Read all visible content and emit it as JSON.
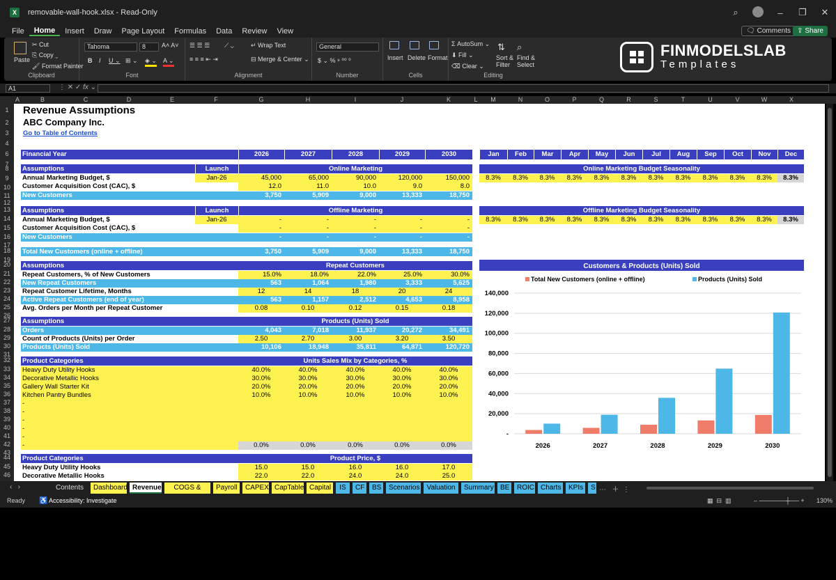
{
  "window": {
    "title": "removable-wall-hook.xlsx  -  Read-Only"
  },
  "menu": [
    "File",
    "Home",
    "Insert",
    "Draw",
    "Page Layout",
    "Formulas",
    "Data",
    "Review",
    "View"
  ],
  "menu_active": "Home",
  "buttons": {
    "comments": "Comments",
    "share": "Share"
  },
  "ribbon": {
    "clipboard": {
      "paste": "Paste",
      "cut": "Cut",
      "copy": "Copy",
      "format_painter": "Format Painter",
      "label": "Clipboard"
    },
    "font": {
      "name": "Tahoma",
      "size": "8",
      "label": "Font"
    },
    "alignment": {
      "wrap": "Wrap Text",
      "merge": "Merge & Center",
      "label": "Alignment"
    },
    "number": {
      "format": "General",
      "label": "Number"
    },
    "cells": {
      "insert": "Insert",
      "delete": "Delete",
      "format": "Format",
      "label": "Cells"
    },
    "editing": {
      "autosum": "AutoSum",
      "fill": "Fill",
      "clear": "Clear",
      "sort": "Sort & Filter",
      "find": "Find & Select",
      "label": "Editing"
    }
  },
  "logo": {
    "line1": "FINMODELSLAB",
    "line2": "Templates"
  },
  "formula": {
    "namebox": "A1",
    "fx": "fx"
  },
  "columns": [
    "A",
    "B",
    "C",
    "D",
    "E",
    "F",
    "G",
    "H",
    "I",
    "J",
    "K",
    "L",
    "M",
    "N",
    "O",
    "P",
    "Q",
    "R",
    "S",
    "T",
    "U",
    "V",
    "W",
    "X"
  ],
  "rows": [
    "1",
    "2",
    "3",
    "4",
    "6",
    "7",
    "8",
    "9",
    "10",
    "11",
    "12",
    "13",
    "14",
    "15",
    "16",
    "17",
    "18",
    "19",
    "20",
    "21",
    "22",
    "23",
    "24",
    "25",
    "26",
    "27",
    "28",
    "29",
    "30",
    "31",
    "32",
    "33",
    "34",
    "35",
    "36",
    "37",
    "38",
    "39",
    "40",
    "41",
    "42",
    "43",
    "44",
    "45",
    "46"
  ],
  "sheet": {
    "title": "Revenue Assumptions",
    "company": "ABC Company Inc.",
    "toc_link": "Go to Table of Contents",
    "fy_label": "Financial Year",
    "years": [
      "2026",
      "2027",
      "2028",
      "2029",
      "2030"
    ],
    "months": [
      "Jan",
      "Feb",
      "Mar",
      "Apr",
      "May",
      "Jun",
      "Jul",
      "Aug",
      "Sep",
      "Oct",
      "Nov",
      "Dec"
    ],
    "online": {
      "assumptions": "Assumptions",
      "launch": "Launch",
      "header": "Online Marketing",
      "budget_label": "Annual Marketing Budget, $",
      "launch_date": "Jan-26",
      "budget": [
        "45,000",
        "65,000",
        "90,000",
        "120,000",
        "150,000"
      ],
      "cac_label": "Customer Acquisition Cost (CAC), $",
      "cac": [
        "12.0",
        "11.0",
        "10.0",
        "9.0",
        "8.0"
      ],
      "new_label": "New Customers",
      "new": [
        "3,750",
        "5,909",
        "9,000",
        "13,333",
        "18,750"
      ],
      "season_header": "Online Marketing Budget Seasonality",
      "season": [
        "8.3%",
        "8.3%",
        "8.3%",
        "8.3%",
        "8.3%",
        "8.3%",
        "8.3%",
        "8.3%",
        "8.3%",
        "8.3%",
        "8.3%",
        "8.3%"
      ]
    },
    "offline": {
      "assumptions": "Assumptions",
      "launch": "Launch",
      "header": "Offline Marketing",
      "budget_label": "Annual Marketing Budget, $",
      "launch_date": "Jan-26",
      "budget": [
        "-",
        "-",
        "-",
        "-",
        "-"
      ],
      "cac_label": "Customer Acquisition Cost (CAC), $",
      "cac": [
        "-",
        "-",
        "-",
        "-",
        "-"
      ],
      "new_label": "New Customers",
      "new": [
        "-",
        "-",
        "-",
        "-",
        "-"
      ],
      "season_header": "Offline Marketing Budget Seasonality",
      "season": [
        "8.3%",
        "8.3%",
        "8.3%",
        "8.3%",
        "8.3%",
        "8.3%",
        "8.3%",
        "8.3%",
        "8.3%",
        "8.3%",
        "8.3%",
        "8.3%"
      ]
    },
    "total": {
      "label": "Total New Customers (online + offline)",
      "values": [
        "3,750",
        "5,909",
        "9,000",
        "13,333",
        "18,750"
      ]
    },
    "repeat": {
      "assumptions": "Assumptions",
      "header": "Repeat Customers",
      "r1_label": "Repeat Customers, % of New Customers",
      "r1": [
        "15.0%",
        "18.0%",
        "22.0%",
        "25.0%",
        "30.0%"
      ],
      "r2_label": "New Repeat Customers",
      "r2": [
        "563",
        "1,064",
        "1,980",
        "3,333",
        "5,625"
      ],
      "r3_label": "Repeat Customer Lifetime, Months",
      "r3": [
        "12",
        "14",
        "18",
        "20",
        "24"
      ],
      "r4_label": "Active Repeat Customers (end of year)",
      "r4": [
        "563",
        "1,157",
        "2,512",
        "4,653",
        "8,958"
      ],
      "r5_label": "Avg. Orders per Month per Repeat Customer",
      "r5": [
        "0.08",
        "0.10",
        "0.12",
        "0.15",
        "0.18"
      ]
    },
    "products": {
      "assumptions": "Assumptions",
      "header": "Products (Units) Sold",
      "orders_label": "Orders",
      "orders": [
        "4,043",
        "7,018",
        "11,937",
        "20,272",
        "34,491"
      ],
      "count_label": "Count of Products (Units) per Order",
      "count": [
        "2.50",
        "2.70",
        "3.00",
        "3.20",
        "3.50"
      ],
      "sold_label": "Products (Units) Sold",
      "sold": [
        "10,106",
        "18,948",
        "35,811",
        "64,871",
        "120,720"
      ]
    },
    "mix": {
      "categories_label": "Product Categories",
      "header": "Units Sales Mix by Categories, %",
      "items": [
        {
          "name": "Heavy Duty Utility Hooks",
          "values": [
            "40.0%",
            "40.0%",
            "40.0%",
            "40.0%",
            "40.0%"
          ]
        },
        {
          "name": "Decorative Metallic Hooks",
          "values": [
            "30.0%",
            "30.0%",
            "30.0%",
            "30.0%",
            "30.0%"
          ]
        },
        {
          "name": "Gallery Wall Starter Kit",
          "values": [
            "20.0%",
            "20.0%",
            "20.0%",
            "20.0%",
            "20.0%"
          ]
        },
        {
          "name": "Kitchen Pantry Bundles",
          "values": [
            "10.0%",
            "10.0%",
            "10.0%",
            "10.0%",
            "10.0%"
          ]
        }
      ],
      "blank": "-",
      "total": [
        "0.0%",
        "0.0%",
        "0.0%",
        "0.0%",
        "0.0%"
      ]
    },
    "price": {
      "categories_label": "Product Categories",
      "header": "Product Price, $",
      "items": [
        {
          "name": "Heavy Duty Utility Hooks",
          "values": [
            "15.0",
            "15.0",
            "16.0",
            "16.0",
            "17.0"
          ]
        },
        {
          "name": "Decorative Metallic Hooks",
          "values": [
            "22.0",
            "22.0",
            "24.0",
            "24.0",
            "25.0"
          ]
        }
      ]
    }
  },
  "chart_data": {
    "type": "bar",
    "title": "Customers & Products (Units) Sold",
    "categories": [
      "2026",
      "2027",
      "2028",
      "2029",
      "2030"
    ],
    "series": [
      {
        "name": "Total New Customers (online + offline)",
        "values": [
          3750,
          5909,
          9000,
          13333,
          18750
        ],
        "color": "#f07d6a"
      },
      {
        "name": "Products (Units) Sold",
        "values": [
          10106,
          18948,
          35811,
          64871,
          120720
        ],
        "color": "#4db8e8"
      }
    ],
    "ylim": [
      0,
      140000
    ],
    "yticks": [
      "-",
      "20,000",
      "40,000",
      "60,000",
      "80,000",
      "100,000",
      "120,000",
      "140,000"
    ],
    "legend": "top",
    "grid": true
  },
  "tabs": [
    "Contents",
    "Dashboard",
    "Revenue",
    "COGS & OPEX",
    "Payroll",
    "CAPEX",
    "CapTable",
    "Capital",
    "IS",
    "CF",
    "BS",
    "Scenarios",
    "Valuation",
    "Summary",
    "BE",
    "ROIC",
    "Charts",
    "KPIs",
    "S"
  ],
  "status": {
    "ready": "Ready",
    "accessibility": "Accessibility: Investigate",
    "zoom": "130%"
  },
  "colors": {
    "header": "#3a3fc0",
    "lightblue": "#4db8e8",
    "yellow": "#fef250",
    "accent": "#4caf50"
  }
}
